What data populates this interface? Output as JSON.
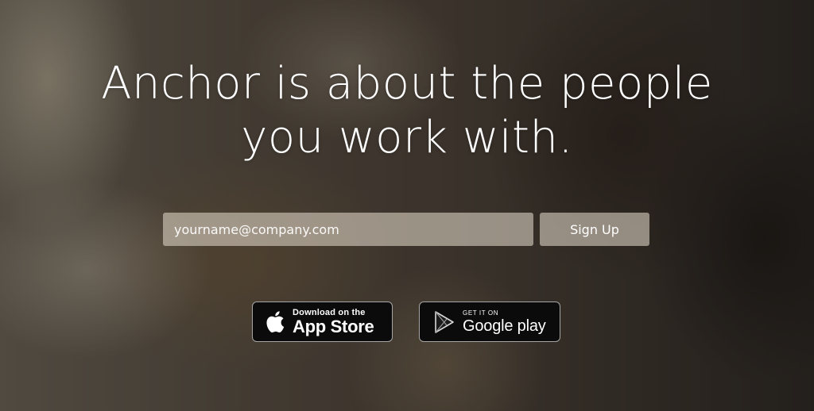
{
  "hero": {
    "headline_line1": "Anchor is about the people",
    "headline_line2": "you work with.",
    "text_color": "#ffffff"
  },
  "signup": {
    "email_placeholder": "yourname@company.com",
    "email_value": "",
    "button_label": "Sign Up"
  },
  "badges": {
    "app_store": {
      "icon": "apple-icon",
      "small_text": "Download on the",
      "large_text": "App Store"
    },
    "google_play": {
      "icon": "google-play-icon",
      "small_text": "GET IT ON",
      "large_text": "Google play"
    }
  }
}
